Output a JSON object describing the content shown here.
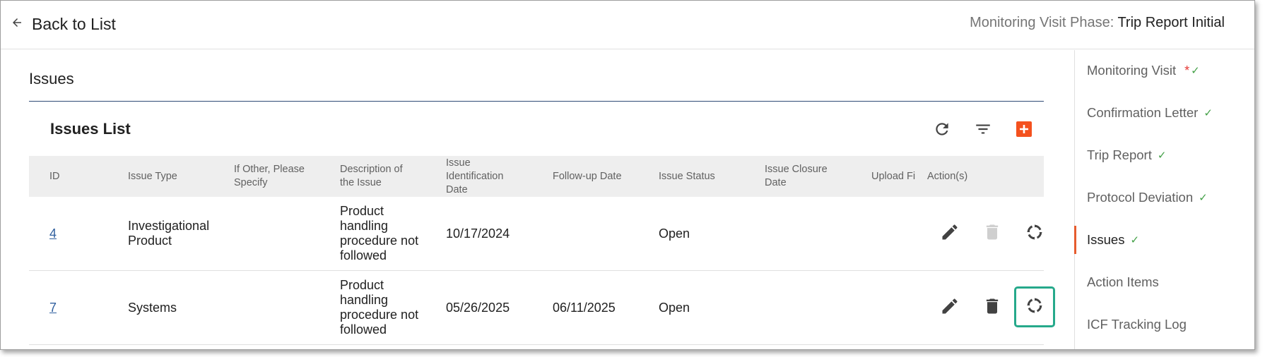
{
  "header": {
    "back_label": "Back to List",
    "phase_label": "Monitoring Visit Phase: ",
    "phase_value": "Trip Report Initial"
  },
  "section": {
    "title": "Issues",
    "list_title": "Issues List"
  },
  "toolbar": {
    "refresh_icon": "refresh-icon",
    "filter_icon": "filter-icon",
    "add_icon": "add-icon",
    "accent_color": "#f4511e"
  },
  "table": {
    "columns": [
      "ID",
      "Issue Type",
      "If Other, Please Specify",
      "Description of the Issue",
      "Issue Identification Date",
      "Follow-up Date",
      "Issue Status",
      "Issue Closure Date",
      "Upload Fi",
      "Action(s)"
    ],
    "rows": [
      {
        "id": "4",
        "issue_type": "Investigational Product",
        "other": "",
        "description": "Product handling procedure not followed",
        "identification_date": "10/17/2024",
        "followup_date": "",
        "status": "Open",
        "closure_date": "",
        "upload": "",
        "delete_enabled": false
      },
      {
        "id": "7",
        "issue_type": "Systems",
        "other": "",
        "description": "Product handling procedure not followed",
        "identification_date": "05/26/2025",
        "followup_date": "06/11/2025",
        "status": "Open",
        "closure_date": "",
        "upload": "",
        "delete_enabled": true
      }
    ]
  },
  "sidebar": {
    "items": [
      {
        "label": "Monitoring Visit",
        "required_mark": "*",
        "check": "✓"
      },
      {
        "label": "Confirmation Letter",
        "check": "✓"
      },
      {
        "label": "Trip Report",
        "check": "✓"
      },
      {
        "label": "Protocol Deviation",
        "check": "✓"
      },
      {
        "label": "Issues",
        "check": "✓",
        "active": true
      },
      {
        "label": "Action Items"
      },
      {
        "label": "ICF Tracking Log"
      }
    ]
  }
}
